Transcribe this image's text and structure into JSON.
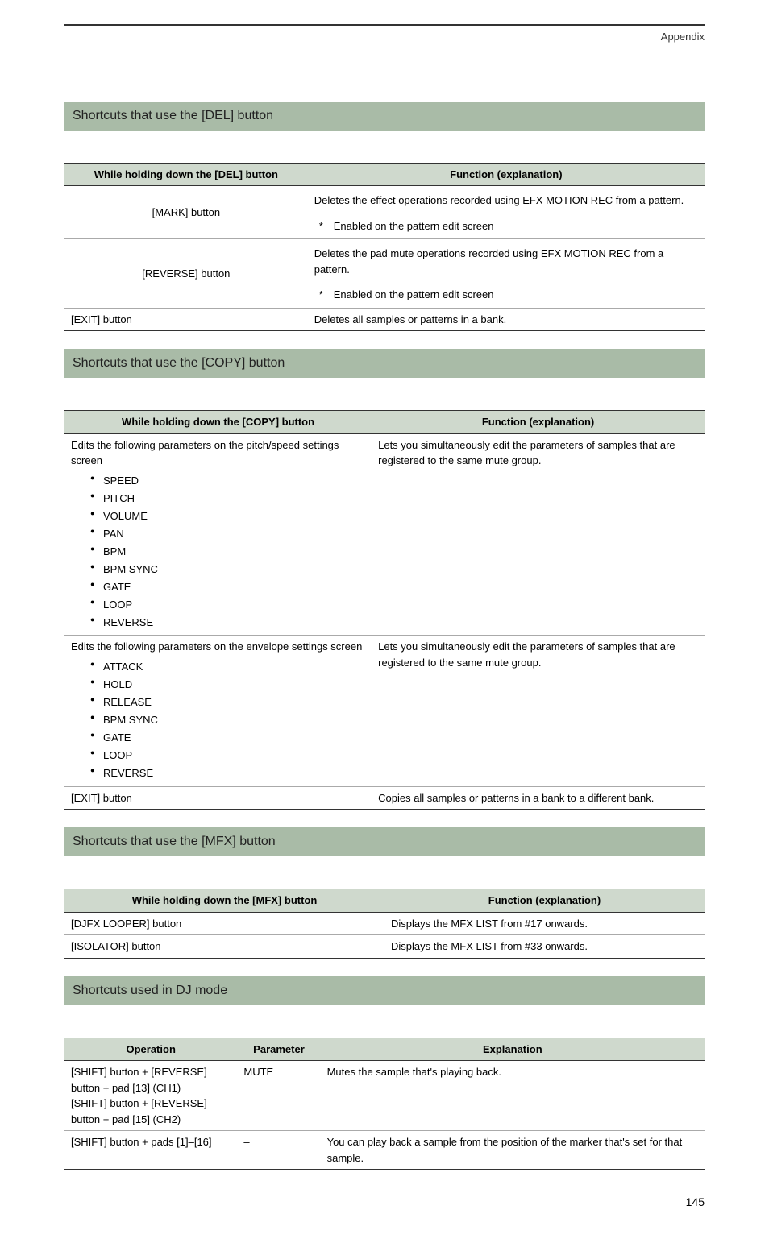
{
  "header": {
    "appendix": "Appendix"
  },
  "section_del": {
    "title": "Shortcuts that use the [DEL] button",
    "col1": "While holding down the [DEL] button",
    "col2": "Function (explanation)",
    "rows": [
      {
        "operation": "[MARK] button",
        "desc": "Deletes the effect operations recorded using EFX MOTION REC from a pattern.",
        "note": "Enabled on the pattern edit screen"
      },
      {
        "operation": "[REVERSE] button",
        "desc": "Deletes the pad mute operations recorded using EFX MOTION REC from a pattern.",
        "note": "Enabled on the pattern edit screen"
      },
      {
        "operation": "[EXIT] button",
        "desc": "Deletes all samples or patterns in a bank."
      }
    ]
  },
  "section_copy": {
    "title": "Shortcuts that use the [COPY] button",
    "col1": "While holding down the [COPY] button",
    "col2": "Function (explanation)",
    "group1": {
      "intro": "Edits the following parameters on the pitch/speed settings screen",
      "params": [
        "SPEED",
        "PITCH",
        "VOLUME",
        "PAN",
        "BPM",
        "BPM SYNC",
        "GATE",
        "LOOP",
        "REVERSE"
      ],
      "desc": "Lets you simultaneously edit the parameters of samples that are registered to the same mute group."
    },
    "group2": {
      "intro": "Edits the following parameters on the envelope settings screen",
      "params": [
        "ATTACK",
        "HOLD",
        "RELEASE",
        "BPM SYNC",
        "GATE",
        "LOOP",
        "REVERSE"
      ],
      "desc": "Lets you simultaneously edit the parameters of samples that are registered to the same mute group."
    },
    "row3": {
      "operation": "[EXIT] button",
      "desc": "Copies all samples or patterns in a bank to a different bank."
    }
  },
  "section_mfx": {
    "title": "Shortcuts that use the [MFX] button",
    "col1": "While holding down the [MFX] button",
    "col2": "Function (explanation)",
    "rows": [
      {
        "operation": "[DJFX LOOPER] button",
        "desc": "Displays the MFX LIST from #17 onwards."
      },
      {
        "operation": "[ISOLATOR] button",
        "desc": "Displays the MFX LIST from #33 onwards."
      }
    ]
  },
  "section_dj": {
    "title": "Shortcuts used in DJ mode",
    "col1": "Operation",
    "col2": "Parameter",
    "col3": "Explanation",
    "rows": [
      {
        "operation": "[SHIFT] button + [REVERSE] button + pad [13] (CH1)\n[SHIFT] button + [REVERSE] button + pad [15] (CH2)",
        "param": "MUTE",
        "desc": "Mutes the sample that's playing back."
      },
      {
        "operation": "[SHIFT] button + pads [1]–[16]",
        "param": "–",
        "desc": "You can play back a sample from the position of the marker that's set for that sample."
      }
    ]
  },
  "page_num": "145"
}
